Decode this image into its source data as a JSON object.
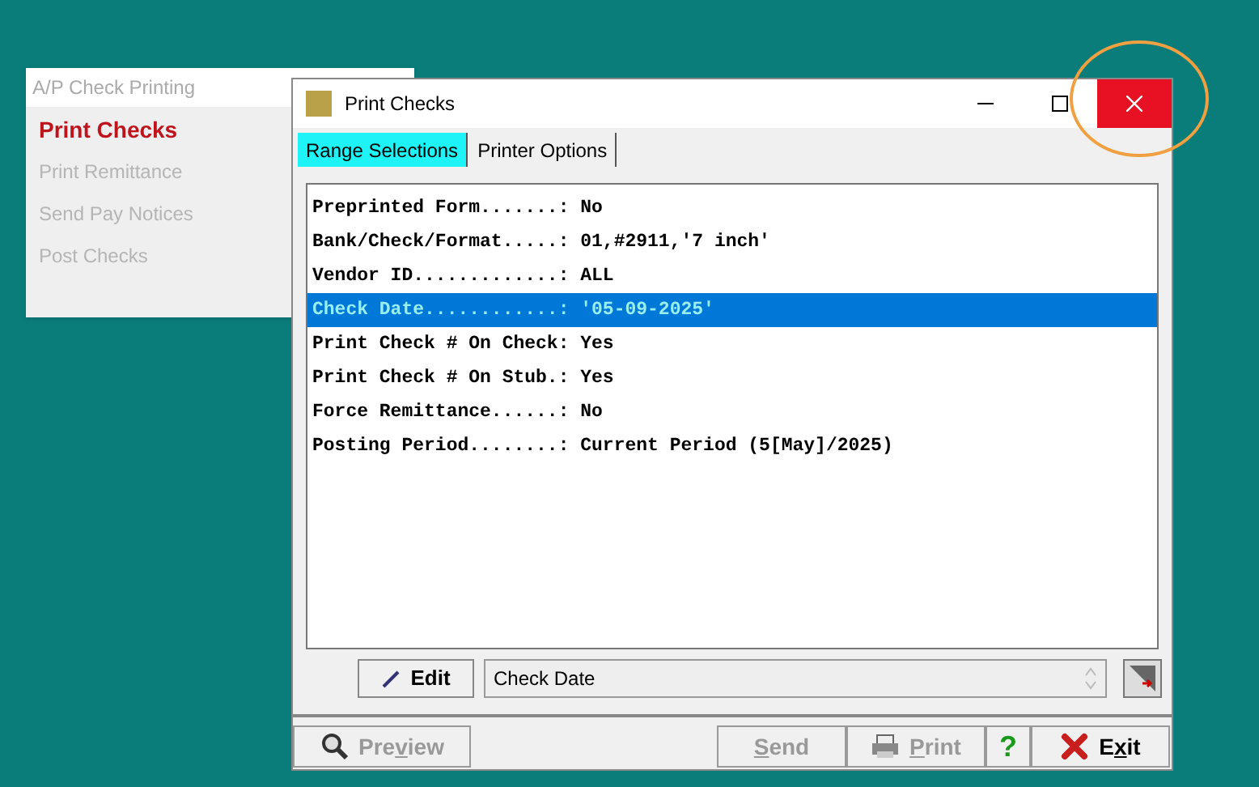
{
  "back_window": {
    "title": "A/P Check Printing",
    "items": [
      {
        "label": "Print Checks",
        "selected": true
      },
      {
        "label": "Print Remittance",
        "selected": false
      },
      {
        "label": "Send Pay Notices",
        "selected": false
      },
      {
        "label": "Post Checks",
        "selected": false
      }
    ]
  },
  "dialog": {
    "title": "Print Checks",
    "close_highlighted": true
  },
  "tabs": [
    {
      "label": "Range Selections",
      "selected": true
    },
    {
      "label": "Printer Options",
      "selected": false
    }
  ],
  "rows": [
    {
      "text": "Preprinted Form.......: No",
      "selected": false
    },
    {
      "text": "Bank/Check/Format.....: 01,#2911,'7 inch'",
      "selected": false
    },
    {
      "text": "Vendor ID.............: ALL",
      "selected": false
    },
    {
      "text": "Check Date............: '05-09-2025'",
      "selected": true
    },
    {
      "text": "Print Check # On Check: Yes",
      "selected": false
    },
    {
      "text": "Print Check # On Stub.: Yes",
      "selected": false
    },
    {
      "text": "Force Remittance......: No",
      "selected": false
    },
    {
      "text": "Posting Period........: Current Period (5[May]/2025)",
      "selected": false
    }
  ],
  "edit_button": {
    "label": "Edit"
  },
  "field": {
    "value": "Check Date"
  },
  "buttons": [
    {
      "kind": "preview",
      "label_parts": [
        {
          "text": "Pre",
          "underline": false
        },
        {
          "text": "v",
          "underline": true
        },
        {
          "text": "iew",
          "underline": false
        }
      ],
      "disabled": true
    },
    {
      "kind": "send",
      "label_parts": [
        {
          "text": "S",
          "underline": true
        },
        {
          "text": "end",
          "underline": false
        }
      ],
      "disabled": true
    },
    {
      "kind": "print",
      "label_parts": [
        {
          "text": "P",
          "underline": true
        },
        {
          "text": "rint",
          "underline": false
        }
      ],
      "disabled": true
    },
    {
      "kind": "help",
      "label_parts": [
        {
          "text": "?",
          "underline": false
        }
      ],
      "disabled": false
    },
    {
      "kind": "exit",
      "label_parts": [
        {
          "text": "E",
          "underline": false
        },
        {
          "text": "x",
          "underline": true
        },
        {
          "text": "it",
          "underline": false
        }
      ],
      "disabled": false
    }
  ]
}
